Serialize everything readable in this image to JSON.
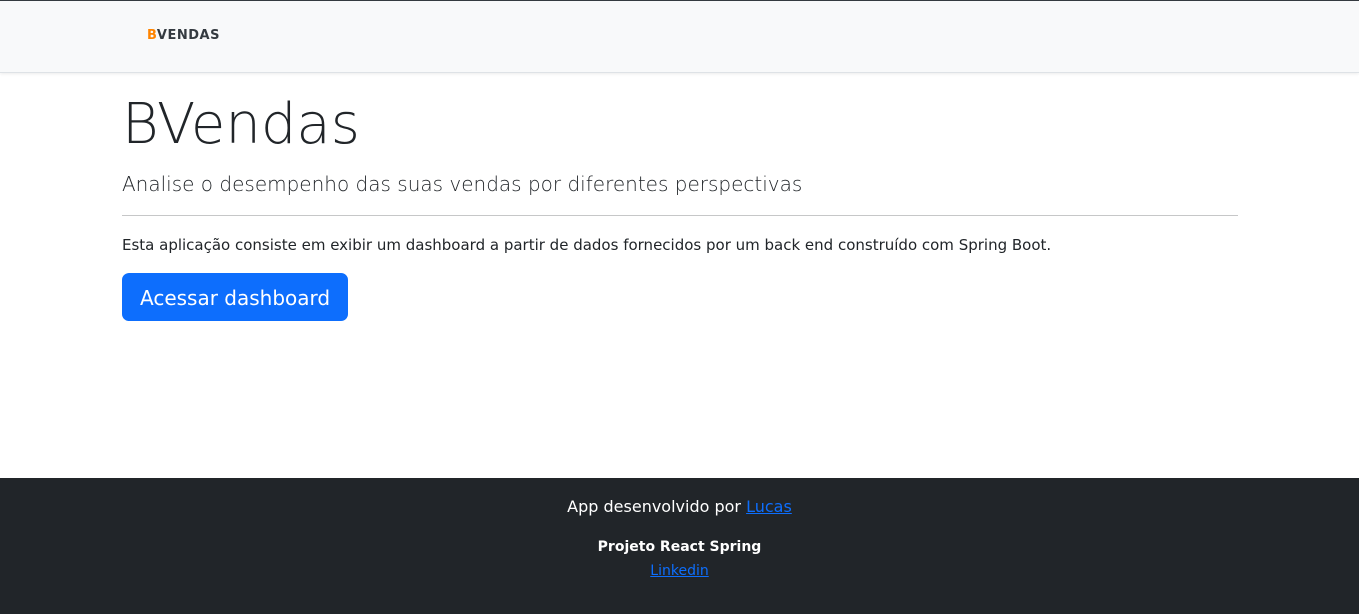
{
  "navbar": {
    "brand_accent": "B",
    "brand_rest": "VENDAS"
  },
  "hero": {
    "title": "BVendas",
    "subtitle": "Analise o desempenho das suas vendas por diferentes perspectivas",
    "description": "Esta aplicação consiste em exibir um dashboard a partir de dados fornecidos por um back end construído com Spring Boot.",
    "button_label": "Acessar dashboard"
  },
  "footer": {
    "credit_prefix": "App desenvolvido por ",
    "credit_link": "Lucas",
    "project_name": "Projeto React Spring",
    "linkedin_label": "Linkedin"
  },
  "colors": {
    "brand_accent": "#ff8400",
    "primary": "#0d6efd",
    "footer_bg": "#212529",
    "navbar_bg": "#f8f9fa"
  }
}
